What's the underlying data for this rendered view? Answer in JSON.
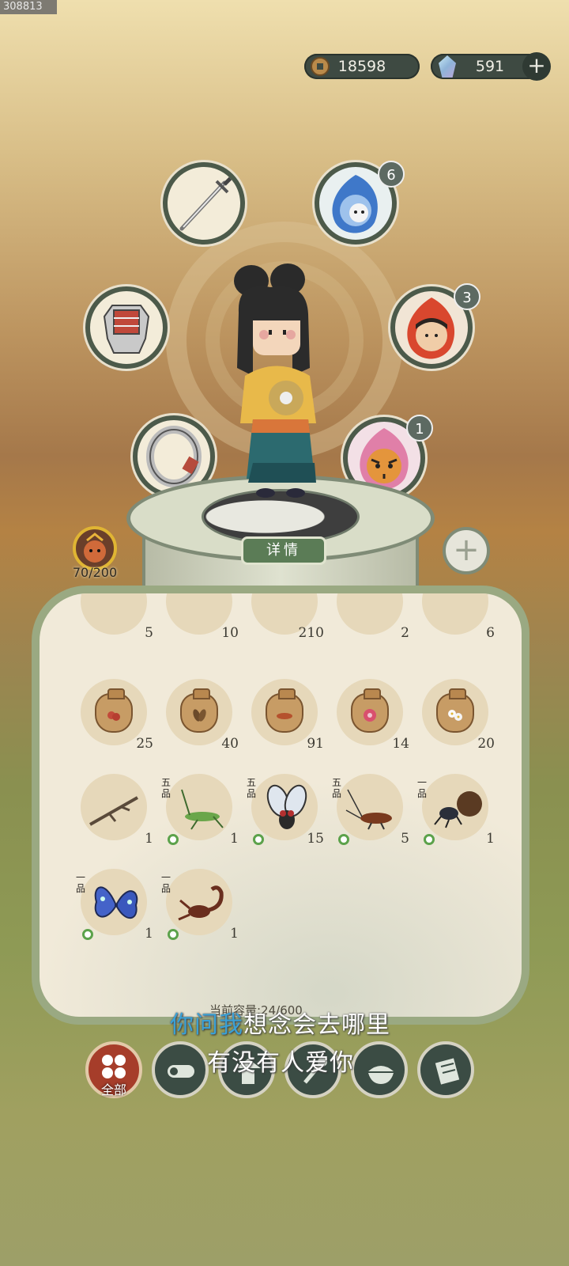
{
  "overlay_tag": "308813",
  "currency": {
    "coins": "18598",
    "gems": "591",
    "add": "+"
  },
  "equipment": {
    "slots": [
      {
        "name": "sword",
        "badge": ""
      },
      {
        "name": "spirit-blue",
        "badge": "6"
      },
      {
        "name": "armor",
        "badge": ""
      },
      {
        "name": "spirit-red",
        "badge": "3"
      },
      {
        "name": "ring",
        "badge": ""
      },
      {
        "name": "spirit-tiger",
        "badge": "1"
      }
    ]
  },
  "detail_button": "详情",
  "add_button": "+",
  "stamina": "70/200",
  "inventory": {
    "top_row_counts": [
      "5",
      "10",
      "210",
      "2",
      "6"
    ],
    "row2": [
      {
        "name": "seed-bag-lychee",
        "count": "25"
      },
      {
        "name": "seed-bag-tea",
        "count": "40"
      },
      {
        "name": "seed-bag-root",
        "count": "91"
      },
      {
        "name": "seed-bag-flower",
        "count": "14"
      },
      {
        "name": "seed-bag-jasmine",
        "count": "20"
      }
    ],
    "row3": [
      {
        "name": "twig",
        "count": "1",
        "grade": ""
      },
      {
        "name": "grasshopper",
        "count": "1",
        "grade": "五品"
      },
      {
        "name": "fly",
        "count": "15",
        "grade": "五品"
      },
      {
        "name": "cockroach",
        "count": "5",
        "grade": "五品"
      },
      {
        "name": "dung-beetle",
        "count": "1",
        "grade": "一品"
      }
    ],
    "row4": [
      {
        "name": "butterfly",
        "count": "1",
        "grade": "一品"
      },
      {
        "name": "scorpion",
        "count": "1",
        "grade": "一品"
      }
    ],
    "capacity": "当前容量:24/600"
  },
  "lyrics": {
    "line1_highlight": "你问我",
    "line1_rest": "想念会去哪里",
    "line2": "有没有人爱你"
  },
  "tabs": {
    "all_label": "全部"
  }
}
